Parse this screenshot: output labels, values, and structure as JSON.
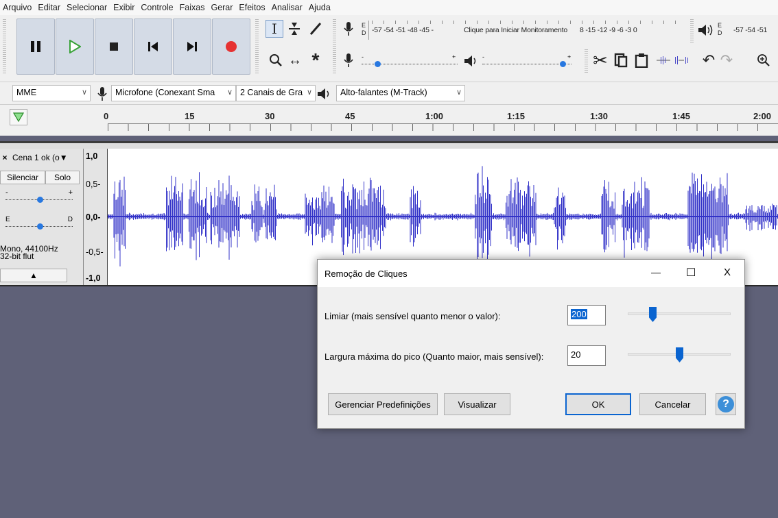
{
  "menu": [
    "Arquivo",
    "Editar",
    "Selecionar",
    "Exibir",
    "Controle",
    "Faixas",
    "Gerar",
    "Efeitos",
    "Analisar",
    "Ajuda"
  ],
  "meters": {
    "record_scale": "-57 -54 -51 -48 -45 -",
    "record_prompt": "Clique para Iniciar Monitoramento",
    "record_scale_right": "8 -15 -12 -9 -6 -3 0",
    "playback_scale": "-57 -54 -51",
    "ed_e": "E",
    "ed_d": "D"
  },
  "devices": {
    "host": "MME",
    "microphone": "Microfone (Conexant Sma",
    "channels": "2 Canais de Gra",
    "speakers": "Alto-falantes (M-Track)"
  },
  "timeline": {
    "ticks": [
      "0",
      "15",
      "30",
      "45",
      "1:00",
      "1:15",
      "1:30",
      "1:45",
      "2:00"
    ]
  },
  "track": {
    "close": "×",
    "name": "Cena 1 ok (o▼",
    "mute": "Silenciar",
    "solo": "Solo",
    "gain_minus": "-",
    "gain_plus": "+",
    "pan_left": "E",
    "pan_right": "D",
    "info_line1": "Mono, 44100Hz",
    "info_line2": "32-bit flut",
    "collapse": "▲",
    "vruler": [
      "1,0",
      "0,5-",
      "0,0-",
      "-0,5-",
      "-1,0"
    ]
  },
  "dialog": {
    "title": "Remoção de Cliques",
    "minimize": "—",
    "maximize": "☐",
    "close": "X",
    "threshold_label": "Limiar (mais sensível quanto menor o valor):",
    "threshold_value": "200",
    "width_label": "Largura máxima do pico (Quanto maior, mais sensível):",
    "width_value": "20",
    "manage_presets": "Gerenciar Predefinições",
    "preview": "Visualizar",
    "ok": "OK",
    "cancel": "Cancelar",
    "help": "?",
    "threshold_slider_fraction": 0.24,
    "width_slider_fraction": 0.5
  },
  "colors": {
    "waveform": "#3232c8",
    "play": "#3aa33a",
    "record": "#e63232",
    "accent": "#0a64d0",
    "background": "#5f6178"
  }
}
